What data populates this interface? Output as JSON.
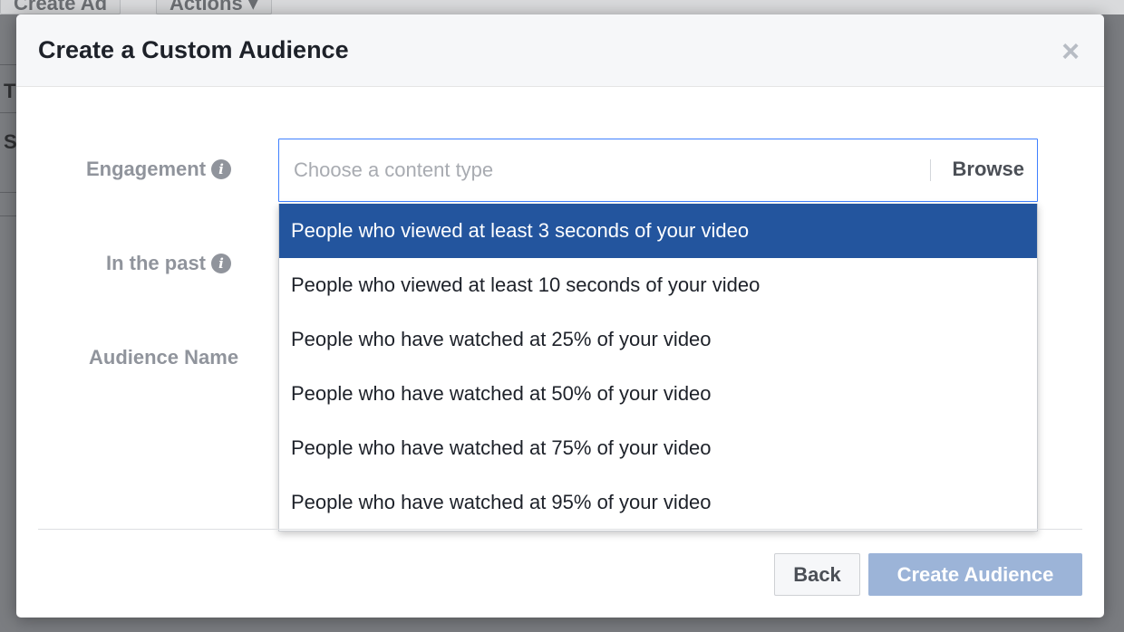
{
  "background": {
    "create_ad_label": "Create Ad",
    "actions_label": "Actions ▾",
    "letters": [
      "T",
      "S"
    ]
  },
  "dialog": {
    "title": "Create a Custom Audience",
    "close_glyph": "×"
  },
  "fields": {
    "engagement": {
      "label": "Engagement",
      "info_glyph": "i"
    },
    "in_the_past": {
      "label": "In the past",
      "info_glyph": "i"
    },
    "audience_name": {
      "label": "Audience Name"
    }
  },
  "content_type": {
    "value": "",
    "placeholder": "Choose a content type",
    "browse_label": "Browse"
  },
  "dropdown": {
    "selected_index": 0,
    "options": [
      "People who viewed at least 3 seconds of your video",
      "People who viewed at least 10 seconds of your video",
      "People who have watched at 25% of your video",
      "People who have watched at 50% of your video",
      "People who have watched at 75% of your video",
      "People who have watched at 95% of your video"
    ]
  },
  "footer": {
    "back_label": "Back",
    "create_label": "Create Audience"
  },
  "colors": {
    "accent": "#4080ff",
    "selected_option": "#23559e",
    "create_button_disabled": "#9cb4d8"
  }
}
